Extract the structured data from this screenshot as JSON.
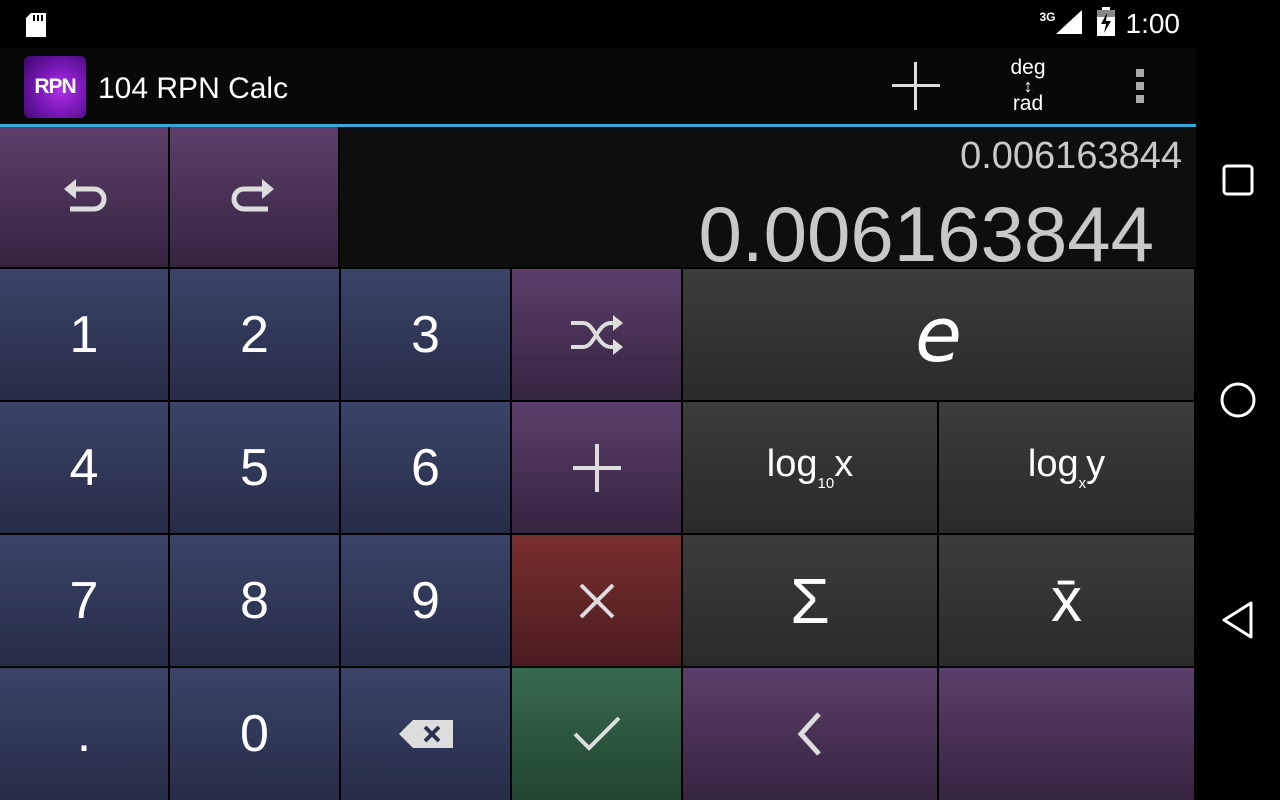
{
  "status_bar": {
    "network_label": "3G",
    "time": "1:00"
  },
  "app_bar": {
    "logo_text": "RPN",
    "title": "104 RPN Calc",
    "angle_mode": {
      "top": "deg",
      "bottom": "rad"
    }
  },
  "display": {
    "stack_level_2": "0.006163844",
    "stack_level_1": "0.006163844"
  },
  "keys": {
    "digits": {
      "one": "1",
      "two": "2",
      "three": "3",
      "four": "4",
      "five": "5",
      "six": "6",
      "seven": "7",
      "eight": "8",
      "nine": "9",
      "zero": "0",
      "dot": "."
    },
    "e_constant": "e",
    "log10": {
      "base": "log",
      "sub": "10",
      "arg": "x"
    },
    "logxy": {
      "base": "log",
      "sub": "x",
      "arg": "y"
    },
    "sum": "Σ",
    "mean": "x̄"
  },
  "colors": {
    "accent_line": "#38a6d8",
    "digit_key": "#323a5c",
    "function_key_purple": "#4e3558",
    "function_key_dark": "#333333",
    "multiply_key": "#6a2828",
    "enter_key": "#2e5a42"
  }
}
